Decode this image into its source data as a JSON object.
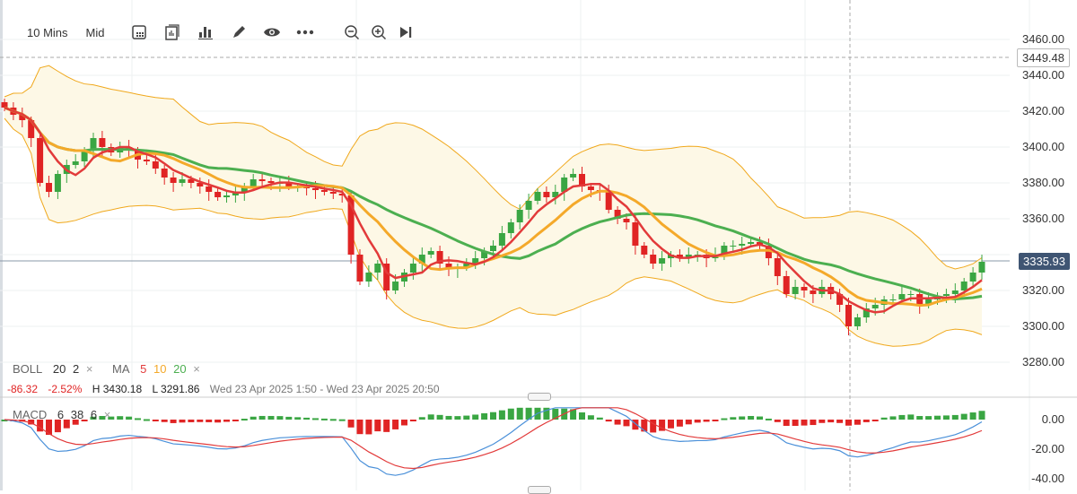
{
  "toolbar": {
    "interval": "10 Mins",
    "price_type": "Mid",
    "icons": [
      "calendar-icon",
      "chart-type-icon",
      "indicators-icon",
      "draw-icon",
      "visibility-icon",
      "more-icon",
      "zoom-out-icon",
      "zoom-in-icon",
      "jump-to-latest-icon"
    ]
  },
  "price_axis": {
    "ticks": [
      "3460.00",
      "3440.00",
      "3420.00",
      "3400.00",
      "3380.00",
      "3360.00",
      "3320.00",
      "3300.00",
      "3280.00"
    ],
    "high_marker": "3449.48",
    "last_price": "3335.93"
  },
  "legend": {
    "boll": "BOLL",
    "boll_p1": "20",
    "boll_p2": "2",
    "ma": "MA",
    "ma1": "5",
    "ma2": "10",
    "ma3": "20",
    "close": "×"
  },
  "stats": {
    "change": "-86.32",
    "change_pct": "-2.52%",
    "high": "H 3430.18",
    "low": "L 3291.86",
    "range": "Wed 23 Apr 2025 1:50 - Wed 23 Apr 2025 20:50"
  },
  "macd": {
    "label": "MACD",
    "p1": "6",
    "p2": "38",
    "p3": "6",
    "close": "×",
    "ticks": [
      "0.00",
      "-20.00",
      "-40.00"
    ]
  },
  "colors": {
    "up": "#3aa643",
    "down": "#e02424",
    "ma5": "#e23a3a",
    "ma10": "#f4a92a",
    "ma20": "#4caf50",
    "boll": "#f0a81c",
    "dif": "#4a90d9",
    "dea": "#e23a3a",
    "last_tag": "#3f5573"
  },
  "chart_data": {
    "type": "candlestick",
    "ylim": [
      3280,
      3460
    ],
    "closes": [
      3422,
      3418,
      3415,
      3405,
      3380,
      3375,
      3385,
      3390,
      3392,
      3398,
      3405,
      3400,
      3397,
      3400,
      3398,
      3393,
      3392,
      3388,
      3383,
      3380,
      3382,
      3380,
      3378,
      3375,
      3372,
      3373,
      3375,
      3378,
      3382,
      3381,
      3380,
      3380,
      3378,
      3378,
      3377,
      3376,
      3375,
      3374,
      3373,
      3340,
      3325,
      3330,
      3335,
      3320,
      3325,
      3330,
      3335,
      3340,
      3342,
      3335,
      3332,
      3333,
      3335,
      3338,
      3342,
      3345,
      3352,
      3358,
      3365,
      3370,
      3375,
      3372,
      3375,
      3383,
      3385,
      3378,
      3376,
      3375,
      3365,
      3360,
      3358,
      3345,
      3340,
      3335,
      3338,
      3340,
      3338,
      3340,
      3340,
      3338,
      3340,
      3345,
      3345,
      3346,
      3347,
      3345,
      3338,
      3328,
      3318,
      3322,
      3320,
      3318,
      3322,
      3318,
      3312,
      3300,
      3305,
      3310,
      3312,
      3315,
      3315,
      3318,
      3318,
      3312,
      3315,
      3317,
      3318,
      3320,
      3325,
      3330,
      3336
    ]
  }
}
